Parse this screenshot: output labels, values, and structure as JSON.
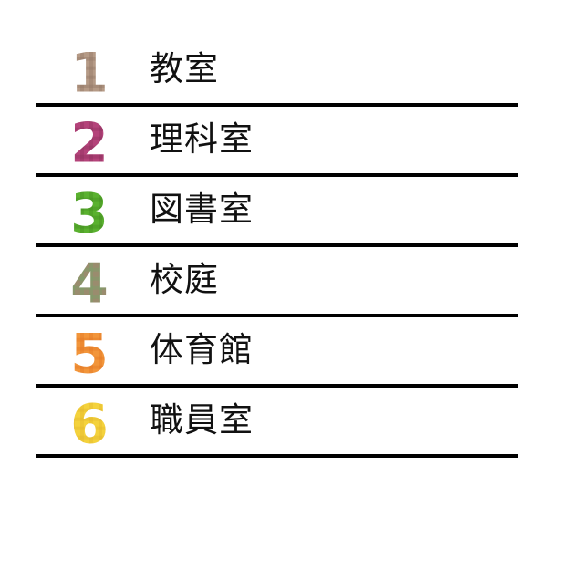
{
  "rooms": [
    {
      "number": "1",
      "label": "教室",
      "color": "#b59a86",
      "accent": "#8c7160"
    },
    {
      "number": "2",
      "label": "理科室",
      "color": "#b4437a",
      "accent": "#8a2d5c"
    },
    {
      "number": "3",
      "label": "図書室",
      "color": "#5ab12f",
      "accent": "#3f8a1c"
    },
    {
      "number": "4",
      "label": "校庭",
      "color": "#9a8c6e",
      "accent": "#78a36a"
    },
    {
      "number": "5",
      "label": "体育館",
      "color": "#f2953a",
      "accent": "#e07320"
    },
    {
      "number": "6",
      "label": "職員室",
      "color": "#f4d23c",
      "accent": "#e0b22a"
    }
  ],
  "icons": {
    "number_icon": "plaid-number-icon"
  }
}
